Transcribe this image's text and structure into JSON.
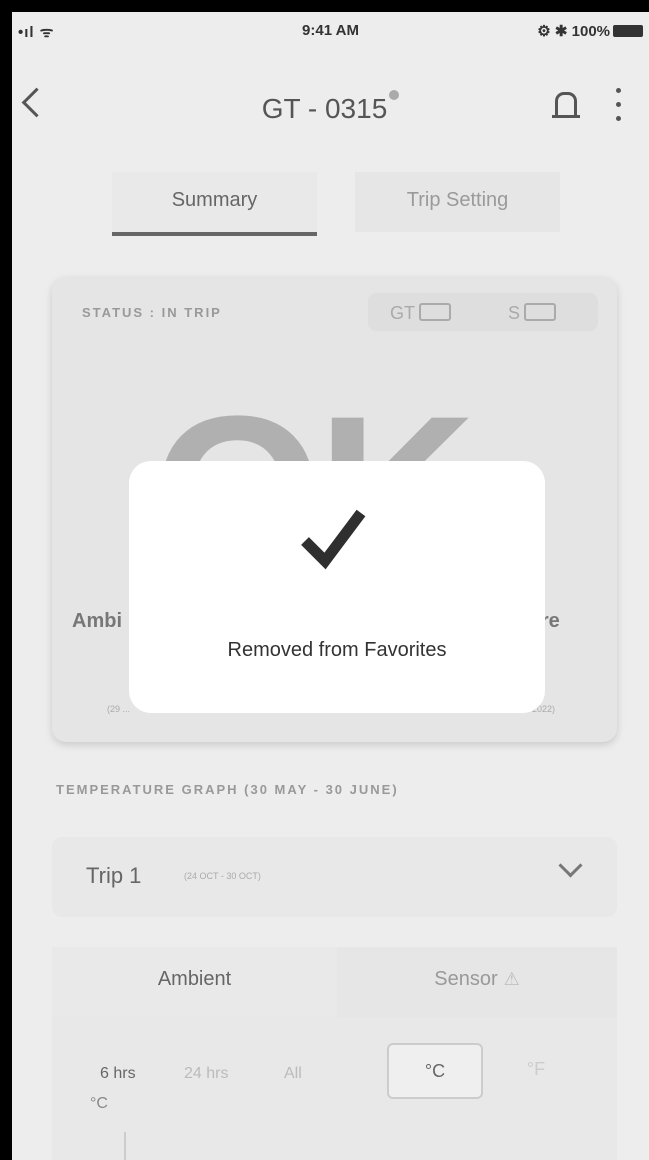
{
  "status_bar": {
    "left": "•ıl ᯤ",
    "time": "9:41 AM",
    "right": "⚙ ✱ 100%"
  },
  "header": {
    "title": "GT - 0315"
  },
  "tabs": [
    {
      "label": "Summary"
    },
    {
      "label": "Trip Setting"
    }
  ],
  "status_card": {
    "status": "STATUS : IN TRIP",
    "devices": [
      {
        "label": "GT"
      },
      {
        "label": "S"
      }
    ],
    "big_text": "OK",
    "left_fragment": "Ambi",
    "right_fragment": "ture",
    "left_date": "(29 ...",
    "right_date": "... 2022)"
  },
  "graph": {
    "label": "TEMPERATURE GRAPH   (30 MAY - 30 JUNE)",
    "trip": {
      "name": "Trip 1",
      "dates": "(24 OCT - 30 OCT)"
    },
    "segments": [
      {
        "label": "Ambient"
      },
      {
        "label": "Sensor"
      }
    ],
    "ranges": [
      "6 hrs",
      "24 hrs",
      "All"
    ],
    "units": [
      "°C",
      "°F"
    ],
    "axis_unit": "°C"
  },
  "toast": {
    "message": "Removed from Favorites"
  },
  "colors": {
    "toast_bg": "#ffffff",
    "dim_bg": "#ededed",
    "check": "#2f2f2f"
  }
}
